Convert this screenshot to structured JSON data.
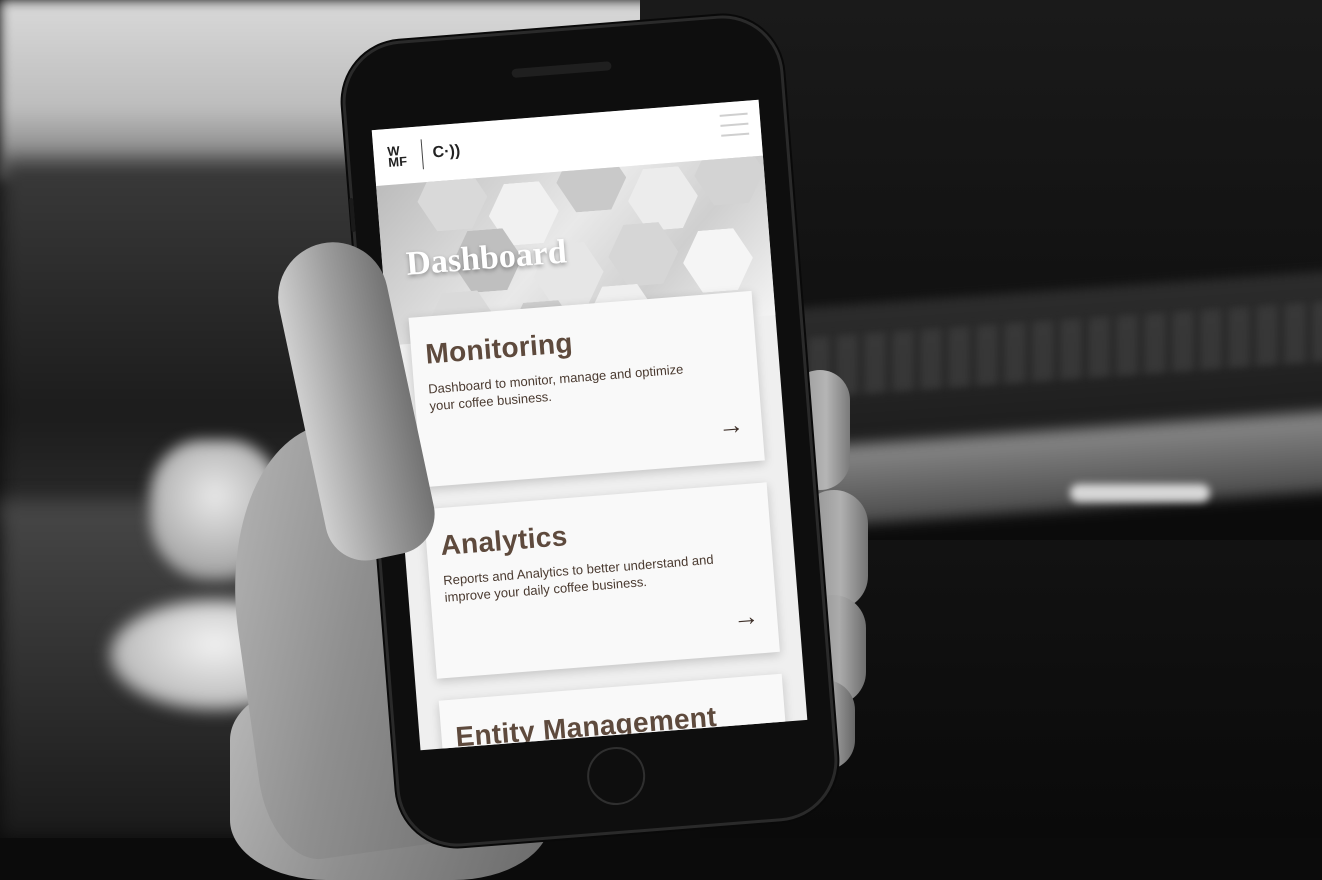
{
  "app": {
    "logo_line1": "W",
    "logo_line2": "MF",
    "connect_logo": "C·))",
    "menu_icon": "hamburger-menu-icon"
  },
  "page": {
    "title": "Dashboard"
  },
  "cards": [
    {
      "title": "Monitoring",
      "description": "Dashboard to monitor, manage and optimize your coffee business.",
      "arrow": "→"
    },
    {
      "title": "Analytics",
      "description": "Reports and Analytics to better understand and improve your daily coffee business.",
      "arrow": "→"
    },
    {
      "title": "Entity Management",
      "description": "",
      "arrow": ""
    }
  ],
  "colors": {
    "card_title": "#5e4a3d",
    "card_text": "#4a3a30",
    "header_bg": "#ffffff",
    "screen_bg": "#efefef"
  }
}
